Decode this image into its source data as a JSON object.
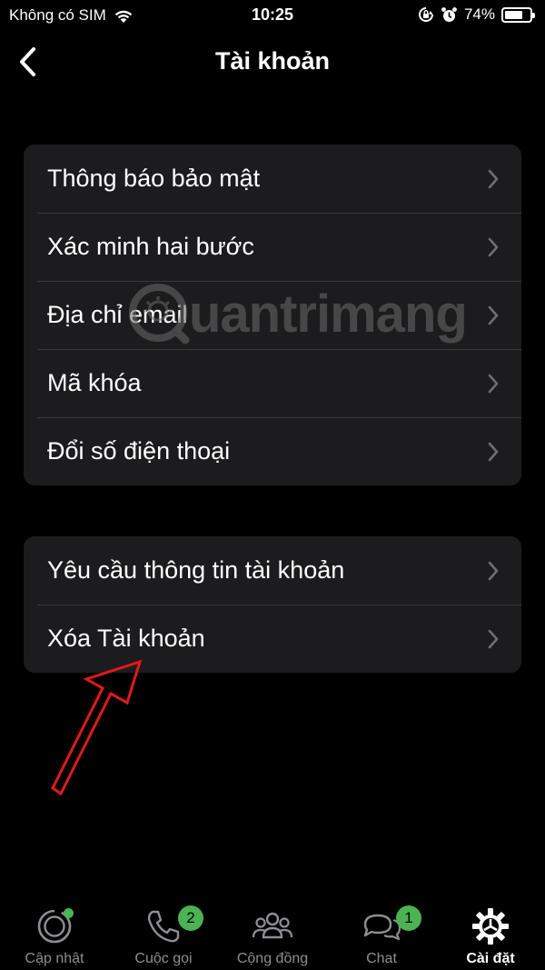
{
  "status_bar": {
    "carrier": "Không có SIM",
    "time": "10:25",
    "battery_percent": "74%",
    "battery_level": 0.74,
    "icons": [
      "wifi-icon",
      "orientation-lock-icon",
      "alarm-icon",
      "battery-icon"
    ]
  },
  "nav": {
    "title": "Tài khoản",
    "back_icon": "chevron-left-icon"
  },
  "groups": [
    {
      "items": [
        {
          "label": "Thông báo bảo mật"
        },
        {
          "label": "Xác minh hai bước"
        },
        {
          "label": "Địa chỉ email"
        },
        {
          "label": "Mã khóa"
        },
        {
          "label": "Đổi số điện thoại"
        }
      ]
    },
    {
      "items": [
        {
          "label": "Yêu cầu thông tin tài khoản"
        },
        {
          "label": "Xóa Tài khoản"
        }
      ]
    }
  ],
  "watermark": {
    "text": "uantrimang"
  },
  "tabs": [
    {
      "label": "Cập nhật",
      "icon": "status-updates-icon",
      "badge": "",
      "active": false
    },
    {
      "label": "Cuộc gọi",
      "icon": "phone-icon",
      "badge": "2",
      "active": false
    },
    {
      "label": "Cộng đồng",
      "icon": "community-icon",
      "badge": "",
      "active": false
    },
    {
      "label": "Chat",
      "icon": "chat-bubbles-icon",
      "badge": "1",
      "active": false
    },
    {
      "label": "Cài đặt",
      "icon": "settings-gear-icon",
      "badge": "",
      "active": true
    }
  ],
  "colors": {
    "background": "#000000",
    "cell": "#1c1c1e",
    "separator": "#38383a",
    "badge": "#4bb352",
    "annotation_arrow": "#e0191b",
    "inactive_tab": "#8e8e93"
  }
}
